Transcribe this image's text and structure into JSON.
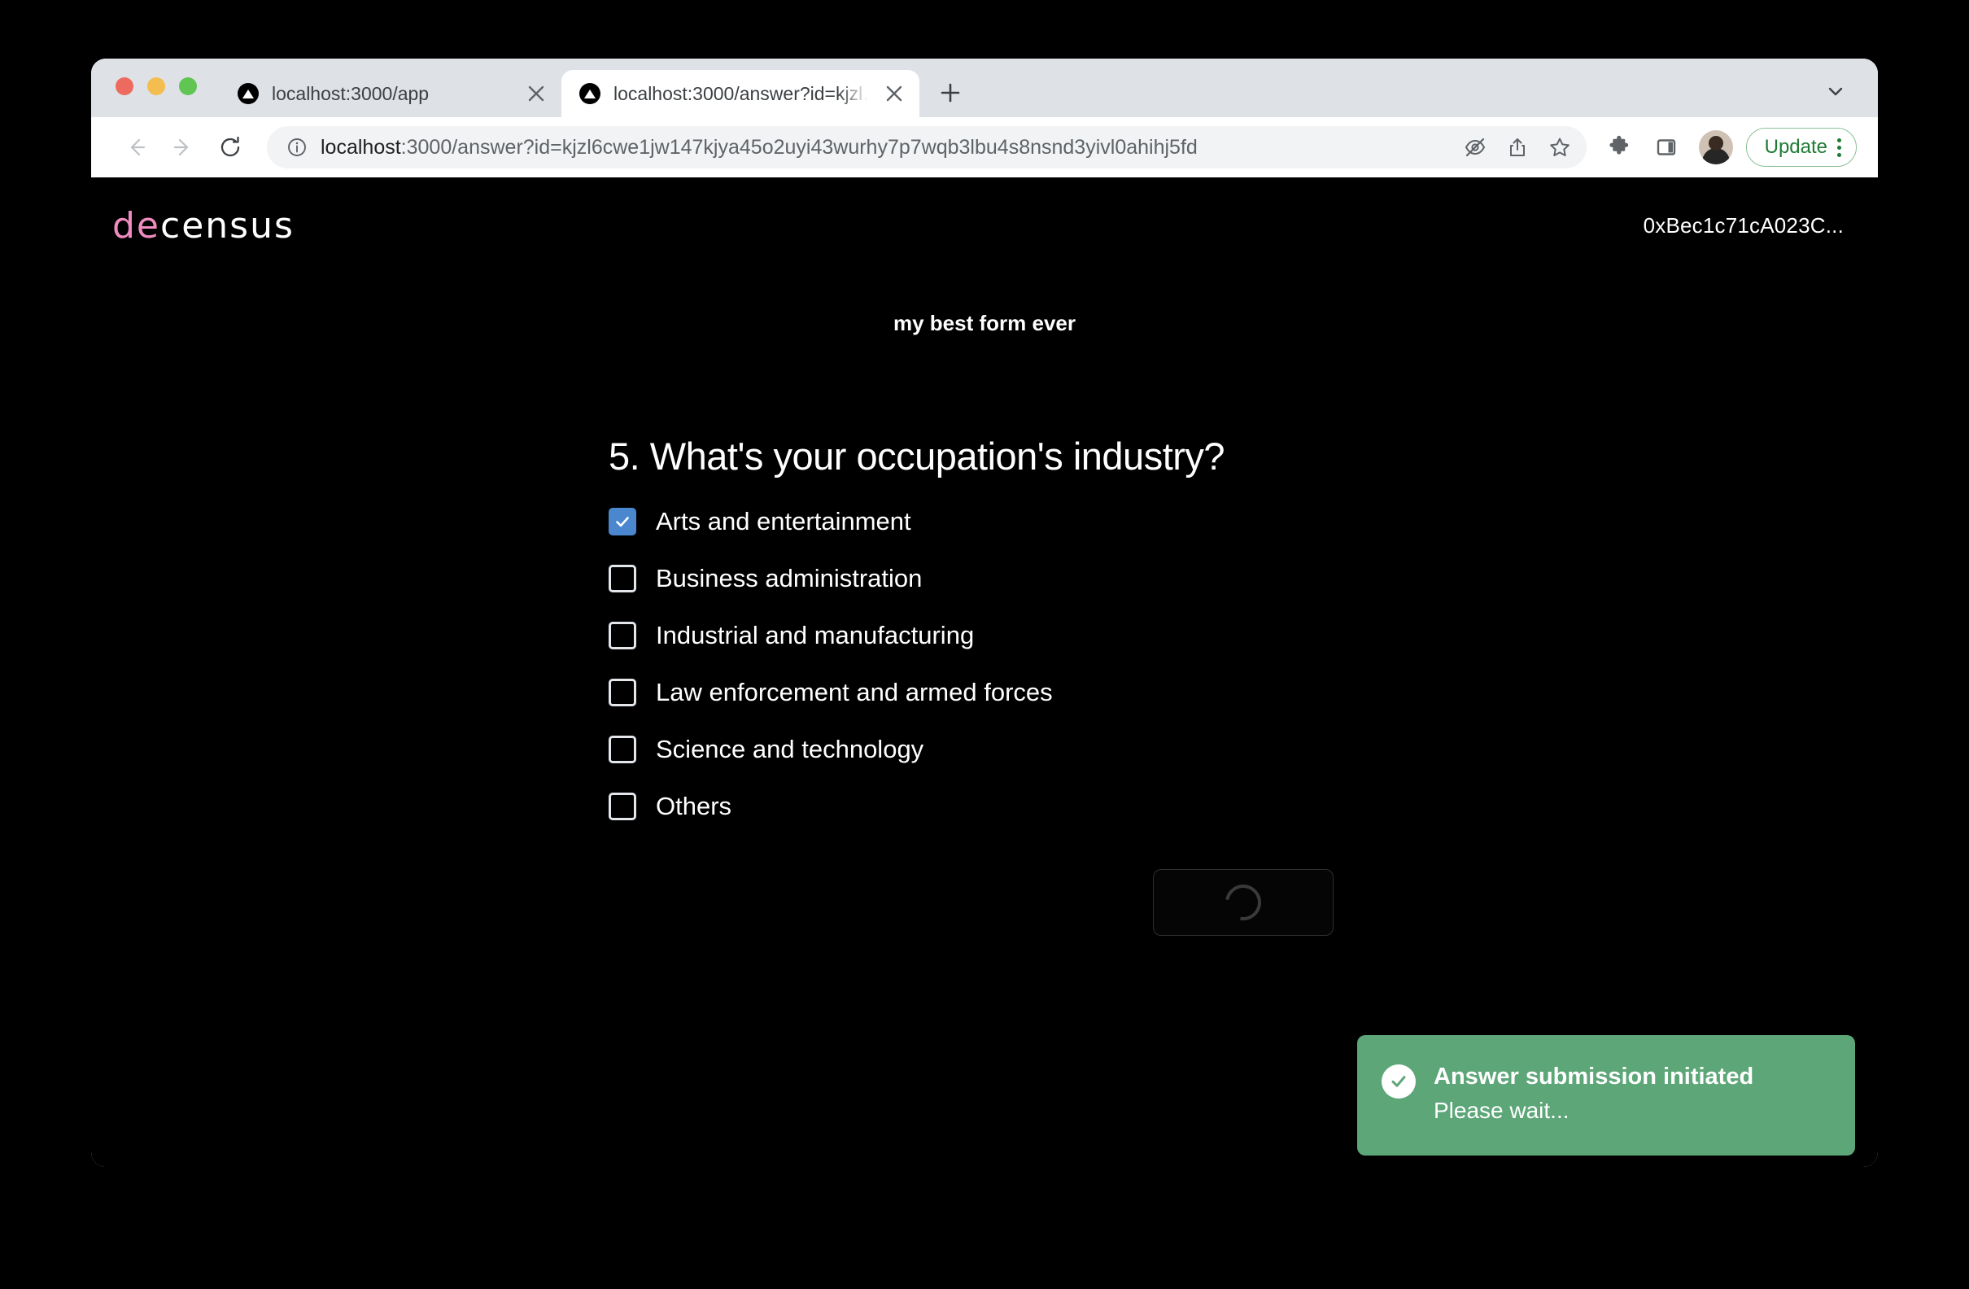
{
  "browser": {
    "tabs": [
      {
        "title": "localhost:3000/app",
        "active": false,
        "favicon": "triangle-favicon"
      },
      {
        "title": "localhost:3000/answer?id=kjzl…",
        "active": true,
        "favicon": "triangle-favicon"
      }
    ],
    "new_tab_label": "+",
    "tab_search_icon": "chevron-down-icon",
    "toolbar": {
      "back_icon": "arrow-left-icon",
      "forward_icon": "arrow-right-icon",
      "reload_icon": "reload-icon",
      "site_info_icon": "info-circle-icon",
      "url_host": "localhost",
      "url_path": ":3000/answer?id=kjzl6cwe1jw147kjya45o2uyi43wurhy7p7wqb3lbu4s8nsnd3yivl0ahihj5fd",
      "url_full": "localhost:3000/answer?id=kjzl6cwe1jw147kjya45o2uyi43wurhy7p7wqb3lbu4s8nsnd3yivl0ahihj5fd",
      "eye_off_icon": "eye-off-icon",
      "share_icon": "share-icon",
      "bookmark_icon": "star-icon",
      "extensions_icon": "puzzle-icon",
      "side_panel_icon": "side-panel-icon",
      "avatar_icon": "profile-avatar",
      "update_label": "Update",
      "menu_icon": "kebab-menu-icon"
    }
  },
  "page": {
    "logo": {
      "part1": "de",
      "part2": "census",
      "accent": "#f08cc0"
    },
    "wallet": "0xBec1c71cA023C...",
    "form_title": "my best form ever",
    "question": {
      "number": "5.",
      "text": "5. What's your occupation's industry?",
      "options": [
        {
          "label": "Arts and entertainment",
          "checked": true
        },
        {
          "label": "Business administration",
          "checked": false
        },
        {
          "label": "Industrial and manufacturing",
          "checked": false
        },
        {
          "label": "Law enforcement and armed forces",
          "checked": false
        },
        {
          "label": "Science and technology",
          "checked": false
        },
        {
          "label": "Others",
          "checked": false
        }
      ]
    },
    "submit": {
      "state": "loading",
      "spinner_icon": "spinner-icon",
      "label": ""
    },
    "toast": {
      "icon": "check-circle-icon",
      "title": "Answer submission initiated",
      "subtitle": "Please wait...",
      "color": "#5ca678"
    }
  }
}
